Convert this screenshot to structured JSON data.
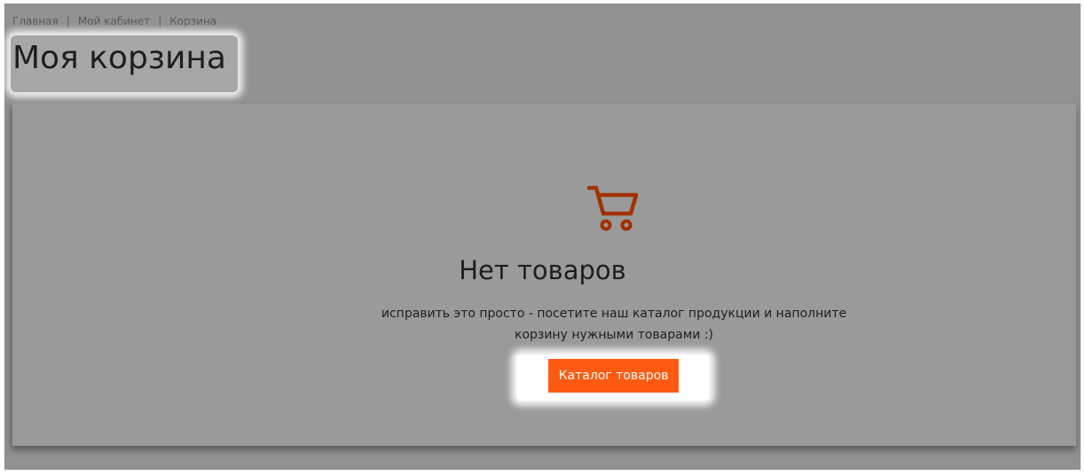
{
  "breadcrumb": {
    "items": [
      "Главная",
      "Мой кабинет",
      "Корзина"
    ],
    "separator": "|"
  },
  "page": {
    "title": "Моя корзина"
  },
  "empty_cart": {
    "icon": "shopping-cart-icon",
    "heading": "Нет товаров",
    "message_line1": "исправить это просто - посетите наш каталог продукции и наполните",
    "message_line2": "корзину нужными товарами :)",
    "button_label": "Каталог товаров"
  },
  "colors": {
    "accent": "#ff5a12",
    "icon": "#a03200",
    "overlay_bg": "#929292"
  }
}
